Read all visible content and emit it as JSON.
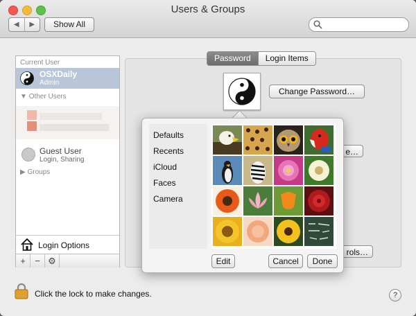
{
  "window": {
    "title": "Users & Groups"
  },
  "toolbar": {
    "back_label": "◀",
    "forward_label": "▶",
    "show_all_label": "Show All",
    "search_placeholder": ""
  },
  "sidebar": {
    "current_user_header": "Current User",
    "current_user": {
      "name": "OSXDaily",
      "role": "Admin"
    },
    "other_users_header": "Other Users",
    "guest": {
      "name": "Guest User",
      "subtitle": "Login, Sharing"
    },
    "groups_header": "Groups",
    "login_options_label": "Login Options",
    "tools": {
      "add": "+",
      "remove": "−",
      "gear": "⚙"
    }
  },
  "tabs": [
    {
      "label": "Password",
      "active": true
    },
    {
      "label": "Login Items",
      "active": false
    }
  ],
  "panel": {
    "change_password_label": "Change Password…",
    "partial_button_1": "e…",
    "partial_button_2": "rols…"
  },
  "picker": {
    "sources": [
      "Defaults",
      "Recents",
      "iCloud",
      "Faces",
      "Camera"
    ],
    "selected_source": "Defaults",
    "images": [
      "Eagle",
      "Leopard",
      "Owl",
      "Parrot",
      "Penguin",
      "Zebra",
      "Pink Flower",
      "Dandelion",
      "Orange Flower",
      "Lotus",
      "Orange Tulip",
      "Red Rose",
      "Sunflower",
      "Pink Rose",
      "Gerbera",
      "Chalkboard"
    ],
    "edit_label": "Edit",
    "cancel_label": "Cancel",
    "done_label": "Done"
  },
  "footer": {
    "lock_text": "Click the lock to make changes.",
    "help_label": "?"
  },
  "colors": {
    "selection": "#b9c6d9",
    "tab_active": "#7a7a7a"
  }
}
